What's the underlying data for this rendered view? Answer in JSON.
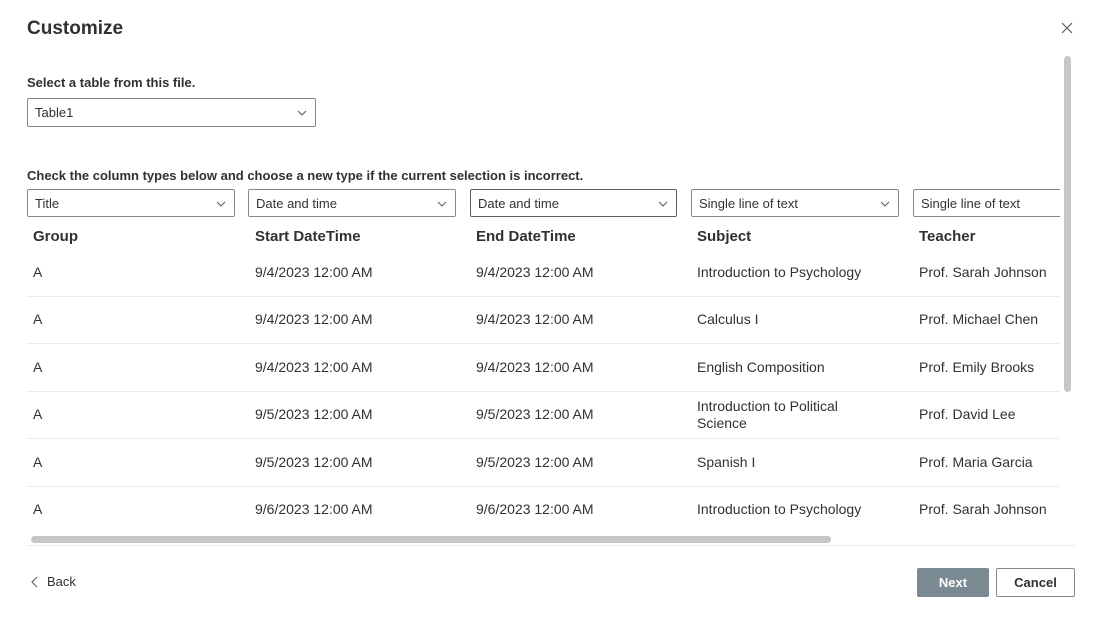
{
  "dialog": {
    "title": "Customize"
  },
  "table_select": {
    "label": "Select a table from this file.",
    "value": "Table1"
  },
  "columns_hint": "Check the column types below and choose a new type if the current selection is incorrect.",
  "columns": [
    {
      "type": "Title",
      "header": "Group"
    },
    {
      "type": "Date and time",
      "header": "Start DateTime"
    },
    {
      "type": "Date and time",
      "header": "End DateTime"
    },
    {
      "type": "Single line of text",
      "header": "Subject"
    },
    {
      "type": "Single line of text",
      "header": "Teacher"
    }
  ],
  "rows": [
    [
      "A",
      "9/4/2023 12:00 AM",
      "9/4/2023 12:00 AM",
      "Introduction to Psychology",
      "Prof. Sarah Johnson"
    ],
    [
      "A",
      "9/4/2023 12:00 AM",
      "9/4/2023 12:00 AM",
      "Calculus I",
      "Prof. Michael Chen"
    ],
    [
      "A",
      "9/4/2023 12:00 AM",
      "9/4/2023 12:00 AM",
      "English Composition",
      "Prof. Emily Brooks"
    ],
    [
      "A",
      "9/5/2023 12:00 AM",
      "9/5/2023 12:00 AM",
      "Introduction to Political Science",
      "Prof. David Lee"
    ],
    [
      "A",
      "9/5/2023 12:00 AM",
      "9/5/2023 12:00 AM",
      "Spanish I",
      "Prof. Maria Garcia"
    ],
    [
      "A",
      "9/6/2023 12:00 AM",
      "9/6/2023 12:00 AM",
      "Introduction to Psychology",
      "Prof. Sarah Johnson"
    ]
  ],
  "footer": {
    "back_label": "Back",
    "next_label": "Next",
    "cancel_label": "Cancel"
  },
  "icons": {
    "close": "close-icon",
    "back": "chevron-left-icon",
    "dropdown": "chevron-down-icon"
  },
  "colors": {
    "primary_disabled": "#7a8a92",
    "border": "#8a8886",
    "divider": "#edebe9"
  }
}
